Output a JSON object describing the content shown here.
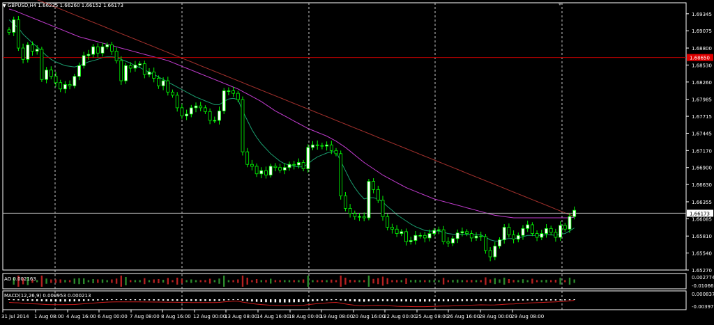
{
  "chart_header": {
    "symbol_line": "GBPUSD,H4  1.66235 1.66260 1.66152 1.66173"
  },
  "colors": {
    "background": "#000000",
    "grid": "#c8c8c8",
    "bull_candle": "#ffffff",
    "bear_candle": "#000000",
    "candle_border": "#00ff00",
    "ma_fast": "#1a9e6e",
    "ma_mid": "#c23ccf",
    "ma_slow": "#a2302c",
    "hline": "#c00000",
    "hline_tag": "#e00000",
    "price_tag": "#ffffff",
    "ao_up": "#2b8a2b",
    "ao_down": "#b52020",
    "macd_bar": "#ffffff",
    "macd_signal": "#d11d1d",
    "axis_text": "#ffffff"
  },
  "chart_data": {
    "type": "candlestick",
    "symbol": "GBPUSD",
    "timeframe": "H4",
    "ylim": [
      1.6527,
      1.6952
    ],
    "y_ticks": [
      "1.69345",
      "1.69075",
      "1.68800",
      "1.68530",
      "1.68260",
      "1.67985",
      "1.67715",
      "1.67445",
      "1.67170",
      "1.66900",
      "1.66630",
      "1.66355",
      "1.66085",
      "1.65810",
      "1.65540",
      "1.65270"
    ],
    "x_ticks": [
      "31 Jul 2014",
      "1 Aug 08:00",
      "4 Aug 16:00",
      "6 Aug 00:00",
      "7 Aug 08:00",
      "8 Aug 16:00",
      "12 Aug 00:00",
      "13 Aug 08:00",
      "14 Aug 16:00",
      "18 Aug 00:00",
      "19 Aug 08:00",
      "20 Aug 16:00",
      "22 Aug 00:00",
      "25 Aug 08:00",
      "26 Aug 16:00",
      "28 Aug 00:00",
      "29 Aug 08:00"
    ],
    "horizontal_line": {
      "value": 1.6865,
      "label": "1.68650"
    },
    "current_price": {
      "value": 1.66173,
      "label": "1.66173"
    },
    "closes": [
      1.6905,
      1.6925,
      1.688,
      1.6862,
      1.6885,
      1.6875,
      1.6878,
      1.683,
      1.6845,
      1.6835,
      1.6825,
      1.6815,
      1.6822,
      1.682,
      1.6835,
      1.6852,
      1.6868,
      1.687,
      1.6882,
      1.6872,
      1.6882,
      1.6885,
      1.6875,
      1.686,
      1.6828,
      1.6852,
      1.6848,
      1.6853,
      1.6855,
      1.6838,
      1.6842,
      1.6832,
      1.682,
      1.6828,
      1.681,
      1.6805,
      1.6785,
      1.6772,
      1.6775,
      1.6785,
      1.6788,
      1.6785,
      1.6779,
      1.6765,
      1.6765,
      1.678,
      1.6812,
      1.6812,
      1.6808,
      1.6798,
      1.6715,
      1.6695,
      1.6692,
      1.668,
      1.6685,
      1.6678,
      1.6692,
      1.669,
      1.6686,
      1.669,
      1.6695,
      1.6694,
      1.6698,
      1.6688,
      1.6722,
      1.6726,
      1.6725,
      1.6724,
      1.6726,
      1.6717,
      1.6712,
      1.6645,
      1.6625,
      1.6617,
      1.6612,
      1.6612,
      1.661,
      1.6668,
      1.6655,
      1.6638,
      1.6612,
      1.6595,
      1.6592,
      1.6585,
      1.6588,
      1.6572,
      1.6574,
      1.6582,
      1.6582,
      1.6578,
      1.6585,
      1.659,
      1.6591,
      1.6572,
      1.657,
      1.6577,
      1.6586,
      1.6588,
      1.6585,
      1.6578,
      1.6581,
      1.658,
      1.6558,
      1.6548,
      1.6565,
      1.6575,
      1.6595,
      1.6583,
      1.6576,
      1.6582,
      1.6593,
      1.6599,
      1.6585,
      1.6579,
      1.6585,
      1.6593,
      1.6587,
      1.6579,
      1.6598,
      1.6592,
      1.6612,
      1.6622
    ],
    "ma_fast": [
      1.6925,
      1.6918,
      1.6912,
      1.6902,
      1.6895,
      1.6888,
      1.6882,
      1.6875,
      1.6868,
      1.6862,
      1.6858,
      1.6855,
      1.6852,
      1.6851,
      1.685,
      1.6852,
      1.6855,
      1.6858,
      1.686,
      1.6862,
      1.6865,
      1.6866,
      1.6866,
      1.6865,
      1.6862,
      1.6859,
      1.6856,
      1.6852,
      1.6849,
      1.6845,
      1.6842,
      1.6838,
      1.6834,
      1.683,
      1.6826,
      1.6822,
      1.6818,
      1.6814,
      1.681,
      1.6806,
      1.6802,
      1.6799,
      1.6796,
      1.6793,
      1.679,
      1.679,
      1.6795,
      1.6799,
      1.68,
      1.6798,
      1.678,
      1.6765,
      1.675,
      1.6738,
      1.6728,
      1.672,
      1.6712,
      1.6706,
      1.67,
      1.6696,
      1.6694,
      1.6692,
      1.6691,
      1.6691,
      1.6696,
      1.6702,
      1.6707,
      1.671,
      1.6713,
      1.6715,
      1.6715,
      1.67,
      1.6685,
      1.667,
      1.6658,
      1.6648,
      1.664,
      1.6642,
      1.6642,
      1.664,
      1.6635,
      1.6628,
      1.6622,
      1.6615,
      1.661,
      1.6605,
      1.66,
      1.6596,
      1.6593,
      1.659,
      1.6589,
      1.6589,
      1.6589,
      1.6587,
      1.6585,
      1.6584,
      1.6584,
      1.6584,
      1.6584,
      1.6583,
      1.6583,
      1.6583,
      1.6579,
      1.6575,
      1.6573,
      1.6573,
      1.6576,
      1.6577,
      1.6577,
      1.6578,
      1.658,
      1.6582,
      1.6582,
      1.6582,
      1.6582,
      1.6583,
      1.6583,
      1.6582,
      1.6584,
      1.6585,
      1.6589,
      1.6594
    ],
    "ma_mid": [
      1.6942,
      1.694,
      1.6937,
      1.6934,
      1.6931,
      1.6928,
      1.6925,
      1.6922,
      1.6919,
      1.6916,
      1.6913,
      1.691,
      1.6907,
      1.6904,
      1.6901,
      1.6898,
      1.6896,
      1.6894,
      1.6892,
      1.689,
      1.6888,
      1.6886,
      1.6884,
      1.6882,
      1.688,
      1.6878,
      1.6876,
      1.6874,
      1.6872,
      1.687,
      1.6868,
      1.6866,
      1.6864,
      1.6862,
      1.686,
      1.6857,
      1.6854,
      1.6851,
      1.6848,
      1.6845,
      1.6842,
      1.6839,
      1.6836,
      1.6833,
      1.683,
      1.6827,
      1.6824,
      1.6821,
      1.6818,
      1.6815,
      1.6811,
      1.6807,
      1.6803,
      1.6799,
      1.6795,
      1.679,
      1.6785,
      1.678,
      1.6776,
      1.6772,
      1.6768,
      1.6764,
      1.676,
      1.6756,
      1.6752,
      1.6749,
      1.6746,
      1.6743,
      1.674,
      1.6736,
      1.6732,
      1.6727,
      1.6722,
      1.6716,
      1.671,
      1.6704,
      1.6698,
      1.6693,
      1.6688,
      1.6683,
      1.6678,
      1.6674,
      1.667,
      1.6666,
      1.6662,
      1.6658,
      1.6655,
      1.6652,
      1.6649,
      1.6646,
      1.6643,
      1.664,
      1.6638,
      1.6636,
      1.6634,
      1.6632,
      1.663,
      1.6628,
      1.6626,
      1.6624,
      1.6622,
      1.662,
      1.6618,
      1.6616,
      1.6614,
      1.6613,
      1.6612,
      1.6611,
      1.661,
      1.661,
      1.661,
      1.661,
      1.661,
      1.661,
      1.661,
      1.661,
      1.661,
      1.661,
      1.661,
      1.661,
      1.661,
      1.6611
    ],
    "ma_slow": [
      1.6975,
      1.6972,
      1.6969,
      1.6966,
      1.6963,
      1.696,
      1.6957,
      1.6954,
      1.6951,
      1.6948,
      1.6945,
      1.6942,
      1.6939,
      1.6936,
      1.6933,
      1.693,
      1.6927,
      1.6924,
      1.6921,
      1.6918,
      1.6915,
      1.6912,
      1.6909,
      1.6906,
      1.6903,
      1.69,
      1.6897,
      1.6894,
      1.6891,
      1.6888,
      1.6885,
      1.6882,
      1.6879,
      1.6876,
      1.6873,
      1.687,
      1.6867,
      1.6864,
      1.6861,
      1.6858,
      1.6855,
      1.6852,
      1.6849,
      1.6846,
      1.6843,
      1.684,
      1.6837,
      1.6834,
      1.6831,
      1.6828,
      1.6825,
      1.6822,
      1.6819,
      1.6816,
      1.6813,
      1.681,
      1.6807,
      1.6804,
      1.6801,
      1.6798,
      1.6795,
      1.6792,
      1.6789,
      1.6786,
      1.6783,
      1.678,
      1.6777,
      1.6774,
      1.6771,
      1.6768,
      1.6765,
      1.6762,
      1.6759,
      1.6756,
      1.6753,
      1.675,
      1.6747,
      1.6744,
      1.6741,
      1.6738,
      1.6735,
      1.6732,
      1.6729,
      1.6726,
      1.6723,
      1.672,
      1.6717,
      1.6714,
      1.6711,
      1.6708,
      1.6705,
      1.6702,
      1.6699,
      1.6696,
      1.6693,
      1.669,
      1.6687,
      1.6684,
      1.6681,
      1.6678,
      1.6675,
      1.6672,
      1.6669,
      1.6666,
      1.6663,
      1.666,
      1.6657,
      1.6654,
      1.6651,
      1.6648,
      1.6645,
      1.6642,
      1.6639,
      1.6636,
      1.6633,
      1.663,
      1.6627,
      1.6624,
      1.6621,
      1.6618,
      1.6615,
      1.6612
    ]
  },
  "indicators": {
    "ao": {
      "label": "AO 0.002163",
      "y_ticks": [
        "0.002774",
        "-0.01066"
      ]
    },
    "macd": {
      "label": "MACD(12,26,9) 0.000953 0.000213",
      "y_ticks": [
        "0.000837",
        "-0.00397"
      ]
    }
  }
}
